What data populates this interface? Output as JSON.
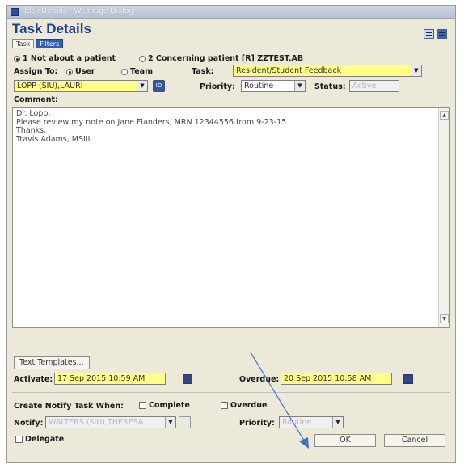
{
  "window": {
    "title": "Task Details - Webpage Dialog"
  },
  "header": {
    "title": "Task Details",
    "tabs": [
      "Task",
      "Filters"
    ]
  },
  "patient": {
    "option1": "1 Not about a patient",
    "option2": "2 Concerning patient [R] ZZTEST,AB",
    "selected": "option1"
  },
  "assign": {
    "label": "Assign To:",
    "user_label": "User",
    "team_label": "Team",
    "selected": "User",
    "assignee": "LOPP (SIU),LAURI",
    "assignee_button": "ID"
  },
  "task": {
    "label": "Task:",
    "value": "Resident/Student Feedback"
  },
  "priority": {
    "label": "Priority:",
    "value": "Routine"
  },
  "status": {
    "label": "Status:",
    "value": "Active"
  },
  "comment": {
    "label": "Comment:",
    "lines": [
      "Dr. Lopp,",
      "Please review my note on Jane Flanders, MRN 12344556 from 9-23-15.",
      "Thanks,",
      "Travis Adams, MSIII"
    ]
  },
  "text_templates_button": "Text Templates...",
  "activate": {
    "label": "Activate:",
    "value": "17 Sep 2015 10:59 AM"
  },
  "overdue": {
    "label": "Overdue:",
    "value": "20 Sep 2015 10:58 AM"
  },
  "notify_task": {
    "label": "Create Notify Task When:",
    "complete_label": "Complete",
    "overdue_label": "Overdue"
  },
  "notify": {
    "label": "Notify:",
    "value": "WALTERS (SIU),THERESA",
    "priority_label": "Priority:",
    "priority_value": "Routine"
  },
  "delegate_label": "Delegate",
  "buttons": {
    "ok": "OK",
    "cancel": "Cancel"
  },
  "colors": {
    "heading": "#1c3f8e",
    "required_field": "#ffff88",
    "tab_active": "#2f5fb8",
    "annotation_arrow": "#3f6fc9"
  }
}
